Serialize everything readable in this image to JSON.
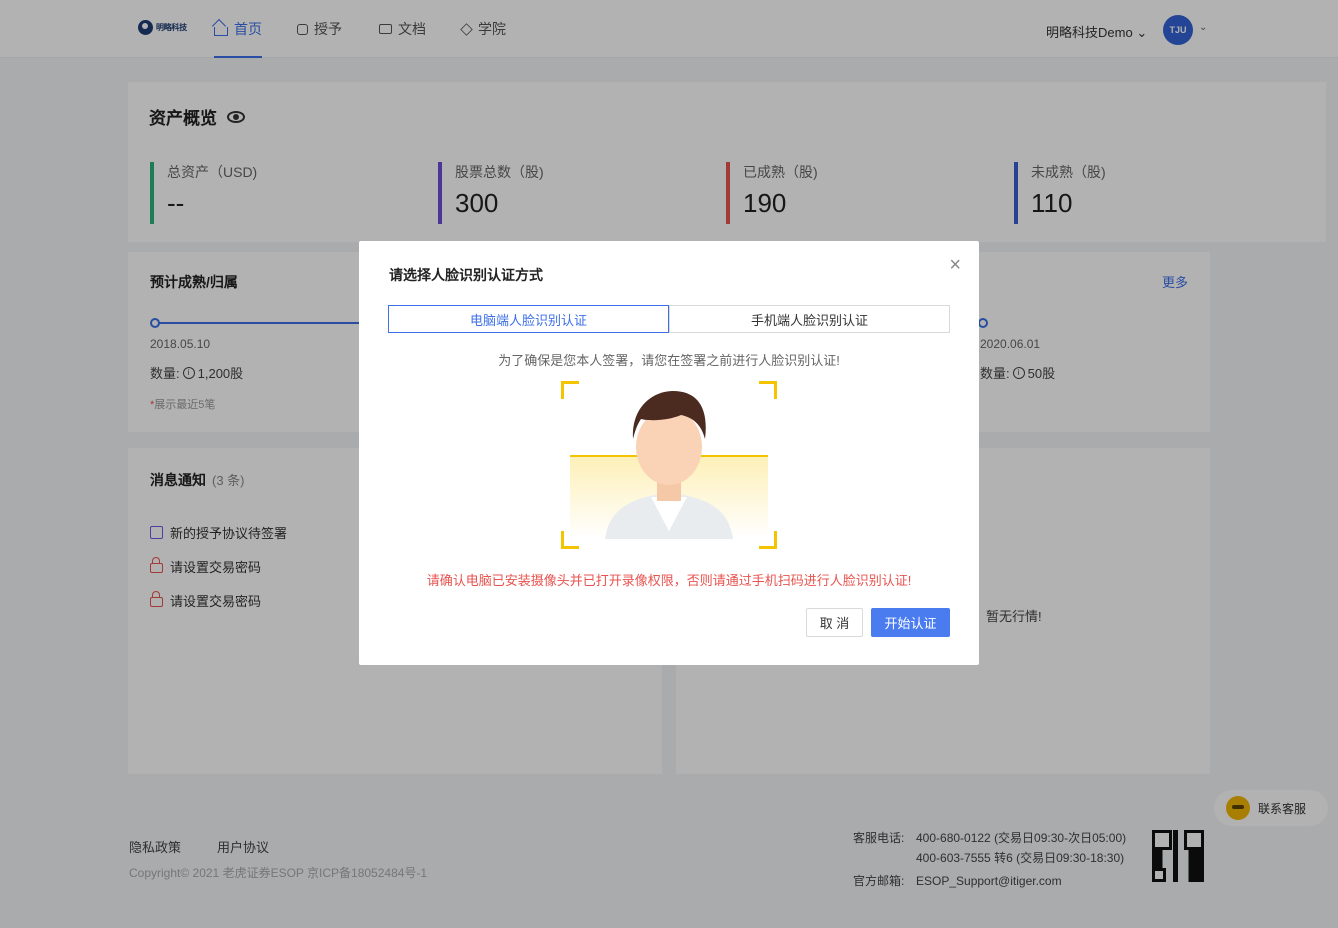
{
  "nav": {
    "logo_text": "明略科技",
    "items": [
      {
        "label": "首页"
      },
      {
        "label": "授予"
      },
      {
        "label": "文档"
      },
      {
        "label": "学院"
      }
    ],
    "company": "明略科技Demo",
    "avatar_text": "TJU"
  },
  "overview": {
    "title": "资产概览",
    "stats": [
      {
        "label": "总资产（USD)",
        "value": "--",
        "color": "#2db37a"
      },
      {
        "label": "股票总数（股)",
        "value": "300",
        "color": "#6c4ed6"
      },
      {
        "label": "已成熟（股)",
        "value": "190",
        "color": "#e8534f"
      },
      {
        "label": "未成熟（股)",
        "value": "110",
        "color": "#3c5fd6"
      }
    ]
  },
  "forecast": {
    "title": "预计成熟/归属",
    "more": "更多",
    "qty_label": "数量:",
    "points": [
      {
        "date": "2018.05.10",
        "qty": "1,200股"
      },
      {
        "date": "2020.06.01",
        "qty": "50股"
      }
    ],
    "note": "展示最近5笔"
  },
  "messages": {
    "title": "消息通知",
    "count": "(3 条)",
    "items": [
      {
        "label": "新的授予协议待签署"
      },
      {
        "label": "请设置交易密码"
      },
      {
        "label": "请设置交易密码"
      }
    ]
  },
  "market": {
    "empty": "暂无行情!"
  },
  "footer": {
    "links": [
      "隐私政策",
      "用户协议"
    ],
    "copyright": "Copyright© 2021 老虎证券ESOP 京ICP备18052484号-1",
    "phone_label": "客服电话:",
    "phone1": "400-680-0122 (交易日09:30-次日05:00)",
    "phone2": "400-603-7555 转6 (交易日09:30-18:30)",
    "email_label": "官方邮箱:",
    "email": "ESOP_Support@itiger.com",
    "support": "联系客服"
  },
  "modal": {
    "title": "请选择人脸识别认证方式",
    "tabs": [
      {
        "label": "电脑端人脸识别认证",
        "active": true
      },
      {
        "label": "手机端人脸识别认证",
        "active": false
      }
    ],
    "tip": "为了确保是您本人签署，请您在签署之前进行人脸识别认证!",
    "warning": "请确认电脑已安装摄像头并已打开录像权限，否则请通过手机扫码进行人脸识别认证!",
    "cancel": "取 消",
    "start": "开始认证"
  },
  "colors": {
    "accent": "#3c6fe8",
    "warning": "#e8534f",
    "scan_frame": "#f5c400"
  }
}
